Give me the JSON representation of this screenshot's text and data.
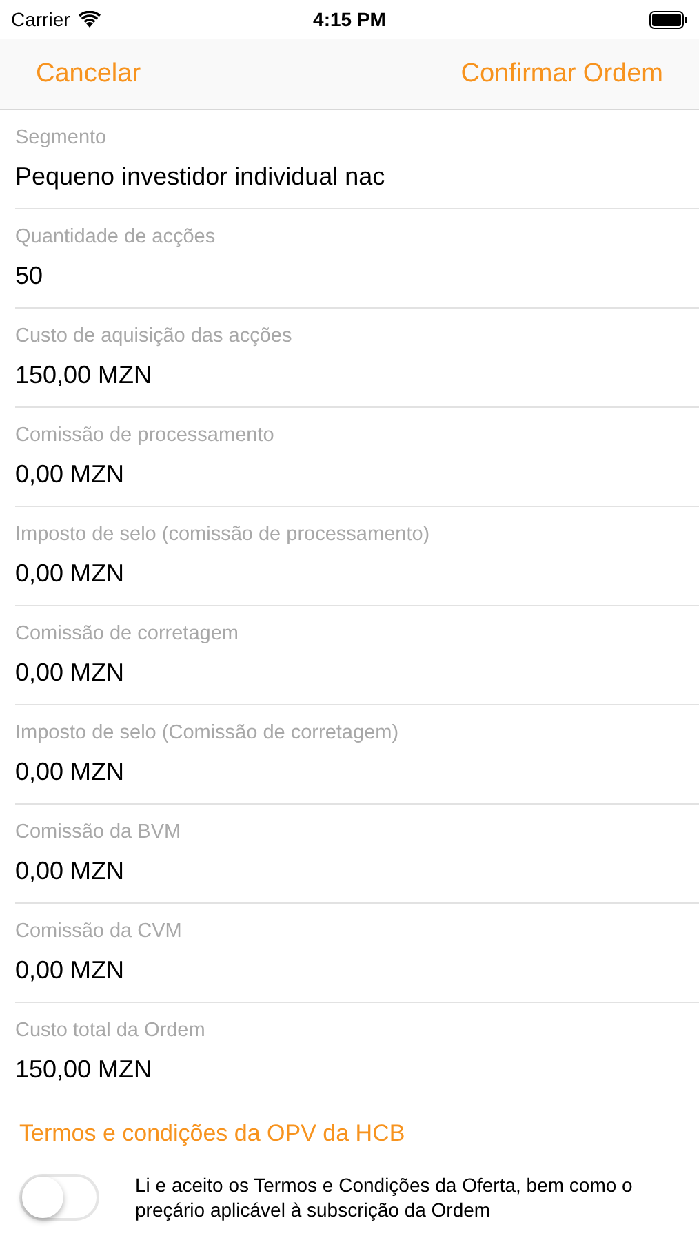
{
  "status_bar": {
    "carrier": "Carrier",
    "time": "4:15 PM"
  },
  "nav_bar": {
    "left_button": "Cancelar",
    "right_button": "Confirmar Ordem"
  },
  "fields": [
    {
      "label": "Segmento",
      "value": "Pequeno investidor individual nac"
    },
    {
      "label": "Quantidade de acções",
      "value": "50"
    },
    {
      "label": "Custo de aquisição das acções",
      "value": "150,00 MZN"
    },
    {
      "label": "Comissão de processamento",
      "value": "0,00 MZN"
    },
    {
      "label": "Imposto de selo (comissão de processamento)",
      "value": "0,00 MZN"
    },
    {
      "label": "Comissão de corretagem",
      "value": "0,00 MZN"
    },
    {
      "label": "Imposto de selo (Comissão de corretagem)",
      "value": "0,00 MZN"
    },
    {
      "label": "Comissão da BVM",
      "value": "0,00 MZN"
    },
    {
      "label": "Comissão da CVM",
      "value": "0,00 MZN"
    },
    {
      "label": "Custo total da Ordem",
      "value": "150,00 MZN"
    }
  ],
  "terms_link": "Termos e condições da OPV da HCB",
  "accept": {
    "text": "Li e aceito os Termos e Condições da Oferta, bem como o preçário aplicável à subscrição da Ordem",
    "on": false
  }
}
